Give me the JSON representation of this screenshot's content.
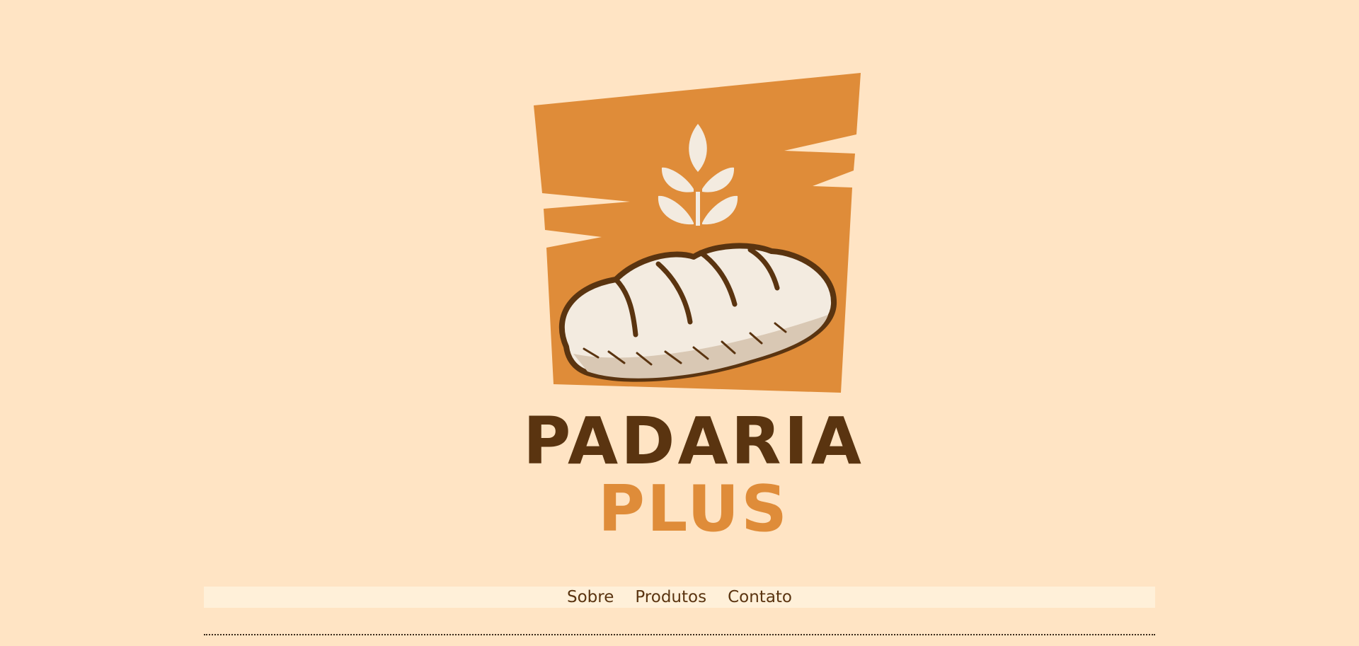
{
  "brand": {
    "name_line1": "PADARIA",
    "name_line2": "PLUS",
    "logo_icon": "bread-loaf-icon",
    "accent_icon": "wheat-icon",
    "colors": {
      "background": "#ffe4c4",
      "logo_square": "#df8c39",
      "dark_brown": "#5a3410",
      "bread_cream": "#f3ebe0",
      "nav_bg": "#fff0d9"
    }
  },
  "nav": {
    "items": [
      {
        "label": "Sobre"
      },
      {
        "label": "Produtos"
      },
      {
        "label": "Contato"
      }
    ]
  }
}
